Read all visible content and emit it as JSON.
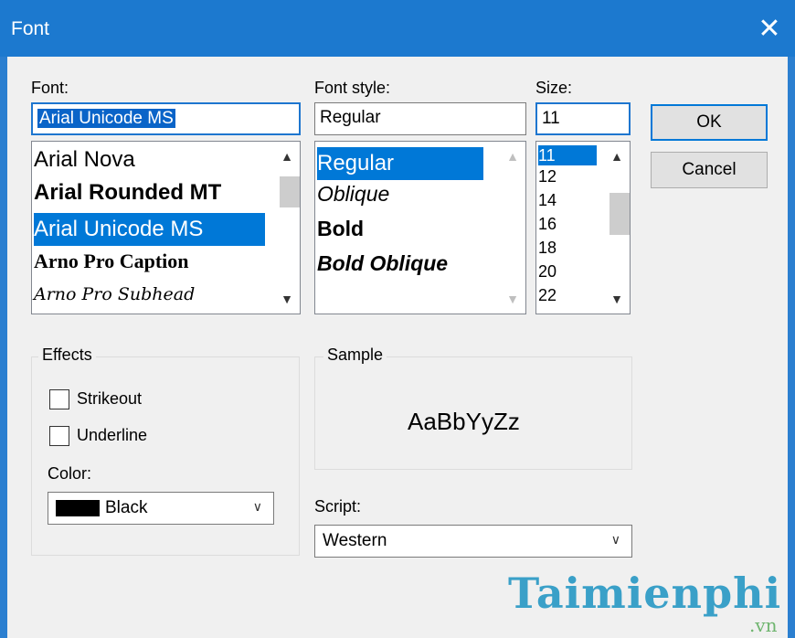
{
  "window": {
    "title": "Font",
    "close_glyph": "✕"
  },
  "font": {
    "label": "Font:",
    "value": "Arial Unicode MS",
    "items": [
      "Arial Nova",
      "Arial Rounded MT",
      "Arial Unicode MS",
      "Arno Pro Caption",
      "Arno Pro Subhead"
    ],
    "selected": "Arial Unicode MS"
  },
  "font_style": {
    "label": "Font style:",
    "value": "Regular",
    "items": [
      "Regular",
      "Oblique",
      "Bold",
      "Bold Oblique"
    ],
    "selected": "Regular"
  },
  "size": {
    "label": "Size:",
    "value": "11",
    "items": [
      "11",
      "12",
      "14",
      "16",
      "18",
      "20",
      "22"
    ],
    "selected": "11"
  },
  "buttons": {
    "ok": "OK",
    "cancel": "Cancel"
  },
  "effects": {
    "title": "Effects",
    "strikeout": "Strikeout",
    "underline": "Underline",
    "strikeout_checked": false,
    "underline_checked": false,
    "color_label": "Color:",
    "color_value": "Black",
    "color_swatch": "#000000"
  },
  "sample": {
    "title": "Sample",
    "text": "AaBbYyZz"
  },
  "script": {
    "label": "Script:",
    "value": "Western"
  },
  "watermark": {
    "text": "Taimienphi",
    "sub": ".vn"
  },
  "colors": {
    "titlebar": "#1c79cf",
    "selection": "#0078d7",
    "accent": "#1e76cf"
  },
  "icons": {
    "scroll_up": "chevron-up-icon",
    "scroll_down": "chevron-down-icon",
    "dropdown": "chevron-down-icon",
    "close": "close-icon"
  }
}
